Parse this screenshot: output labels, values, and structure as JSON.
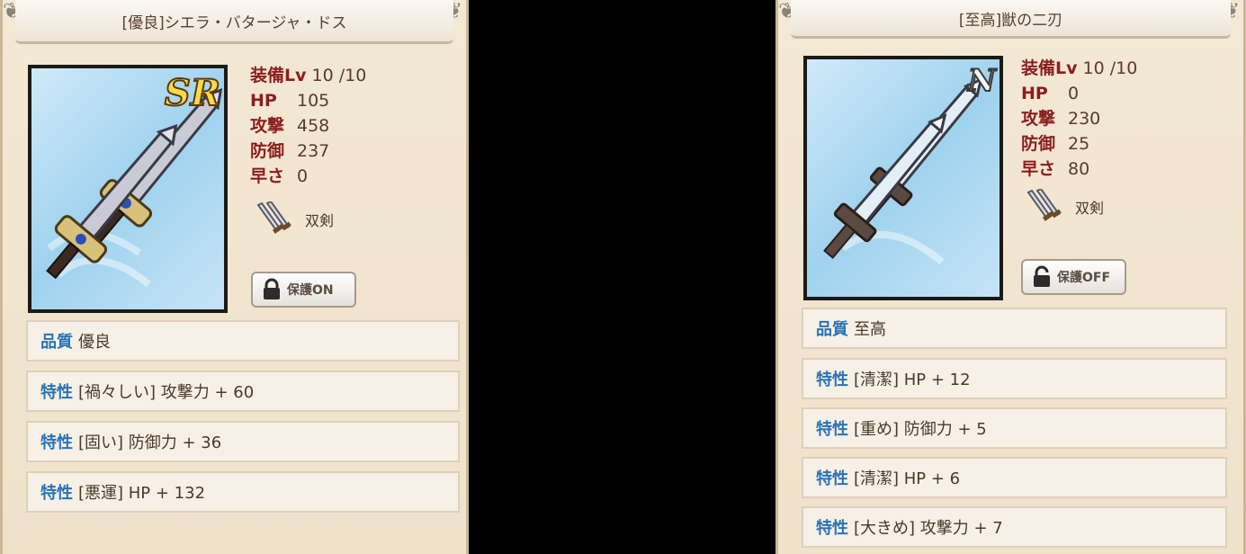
{
  "items": [
    {
      "title": "[優良]シエラ・バタージャ・ドス",
      "rarity": "SR",
      "stats": [
        {
          "label": "装備Lv",
          "value": "10 /10"
        },
        {
          "label": "HP",
          "value": "105"
        },
        {
          "label": "攻撃",
          "value": "458"
        },
        {
          "label": "防御",
          "value": "237"
        },
        {
          "label": "早さ",
          "value": "0"
        }
      ],
      "type": "双剣",
      "protect_label": "保護ON",
      "quality": {
        "key": "品質",
        "value": "優良"
      },
      "traits": [
        {
          "key": "特性",
          "value": "[禍々しい] 攻撃力 + 60"
        },
        {
          "key": "特性",
          "value": "[固い] 防御力 + 36"
        },
        {
          "key": "特性",
          "value": "[悪運] HP + 132"
        }
      ]
    },
    {
      "title": "[至高]獣の二刃",
      "rarity": "N",
      "stats": [
        {
          "label": "装備Lv",
          "value": "10 /10"
        },
        {
          "label": "HP",
          "value": "0"
        },
        {
          "label": "攻撃",
          "value": "230"
        },
        {
          "label": "防御",
          "value": "25"
        },
        {
          "label": "早さ",
          "value": "80"
        }
      ],
      "type": "双剣",
      "protect_label": "保護OFF",
      "quality": {
        "key": "品質",
        "value": "至高"
      },
      "traits": [
        {
          "key": "特性",
          "value": "[清潔] HP + 12"
        },
        {
          "key": "特性",
          "value": "[重め] 防御力 + 5"
        },
        {
          "key": "特性",
          "value": "[清潔] HP + 6"
        },
        {
          "key": "特性",
          "value": "[大きめ] 攻撃力 + 7"
        }
      ]
    }
  ],
  "colors": {
    "stat_label": "#8b1e1e",
    "key_blue": "#2a73b6",
    "panel_bg": "#f1e6d0"
  },
  "icons": [
    "twin-swords-icon",
    "padlock-locked-icon",
    "padlock-unlocked-icon",
    "scroll-ornament-icon"
  ]
}
